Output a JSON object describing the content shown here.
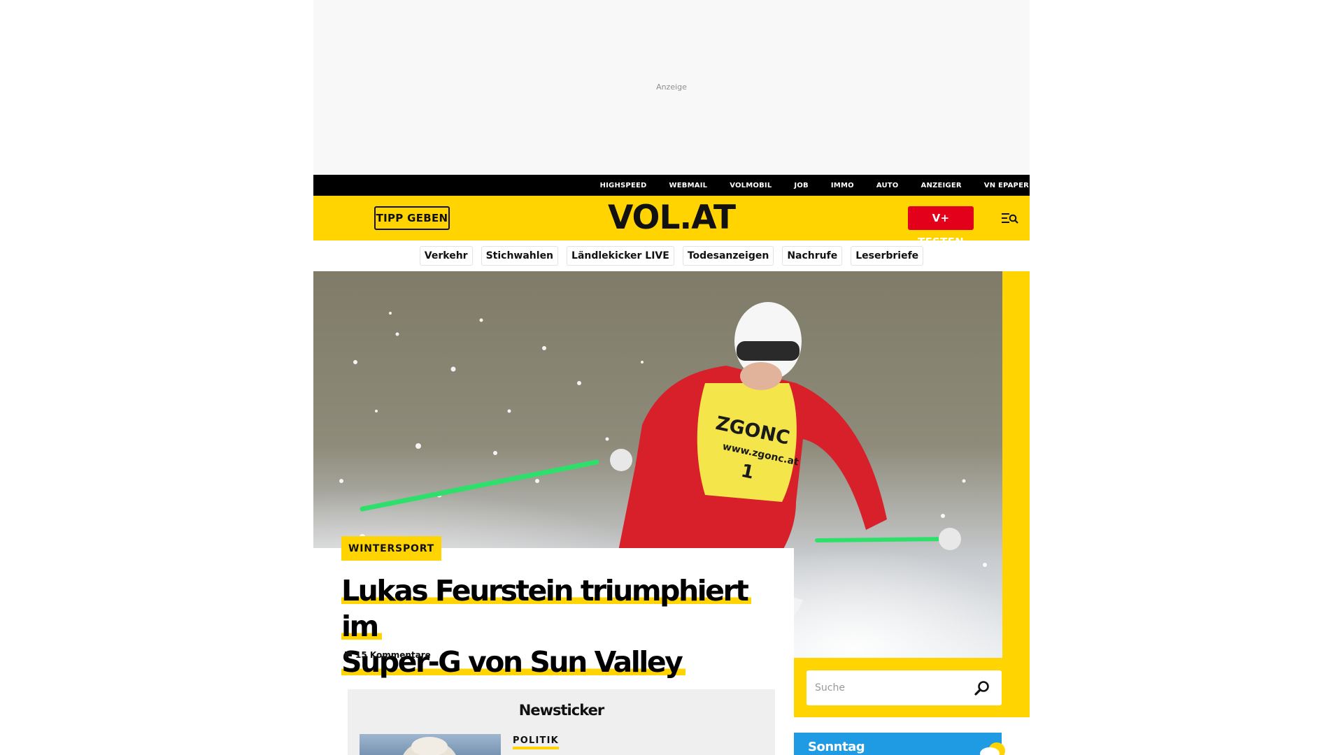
{
  "ad": {
    "label": "Anzeige"
  },
  "topbar": {
    "links": [
      "HIGHSPEED",
      "WEBMAIL",
      "VOLMOBIL",
      "JOB",
      "IMMO",
      "AUTO",
      "ANZEIGER",
      "VN EPAPER"
    ]
  },
  "header": {
    "tipp_label": "TIPP GEBEN",
    "logo": "VOL.AT",
    "vplus_label": "V+ TESTEN",
    "menu_icon": "menu-search-icon"
  },
  "quicknav": {
    "items": [
      "Verkehr",
      "Stichwahlen",
      "Ländlekicker LIVE",
      "Todesanzeigen",
      "Nachrufe",
      "Leserbriefe"
    ]
  },
  "hero": {
    "image": "skier-racing-image",
    "bib_brand": "ZGONC",
    "bib_url": "www.zgonc.at",
    "bib_number": "1"
  },
  "article": {
    "category": "WINTERSPORT",
    "headline_line1": "Lukas Feurstein triumphiert im",
    "headline_line2": "Super-G von Sun Valley",
    "comments": "15 Kommentare"
  },
  "search": {
    "placeholder": "Suche"
  },
  "newsticker": {
    "title": "Newsticker",
    "first_category": "POLITIK"
  },
  "weather": {
    "day": "Sonntag"
  },
  "colors": {
    "brand_yellow": "#ffd400",
    "accent_red": "#e2001a",
    "weather_blue": "#1e9be3"
  }
}
